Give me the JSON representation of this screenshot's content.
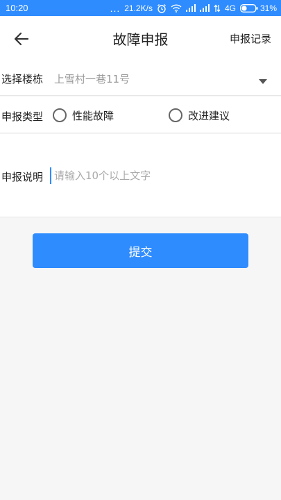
{
  "status_bar": {
    "time": "10:20",
    "dots": "...",
    "speed": "21.2K/s",
    "network": "4G",
    "battery": "31%"
  },
  "header": {
    "title": "故障申报",
    "records_label": "申报记录"
  },
  "form": {
    "building": {
      "label": "选择楼栋",
      "value": "上雪村一巷11号"
    },
    "type": {
      "label": "申报类型",
      "options": [
        {
          "label": "性能故障"
        },
        {
          "label": "改进建议"
        }
      ]
    },
    "description": {
      "label": "申报说明",
      "placeholder": "请输入10个以上文字"
    }
  },
  "submit_label": "提交",
  "colors": {
    "accent": "#2f8cff",
    "background": "#f6f6f6"
  }
}
